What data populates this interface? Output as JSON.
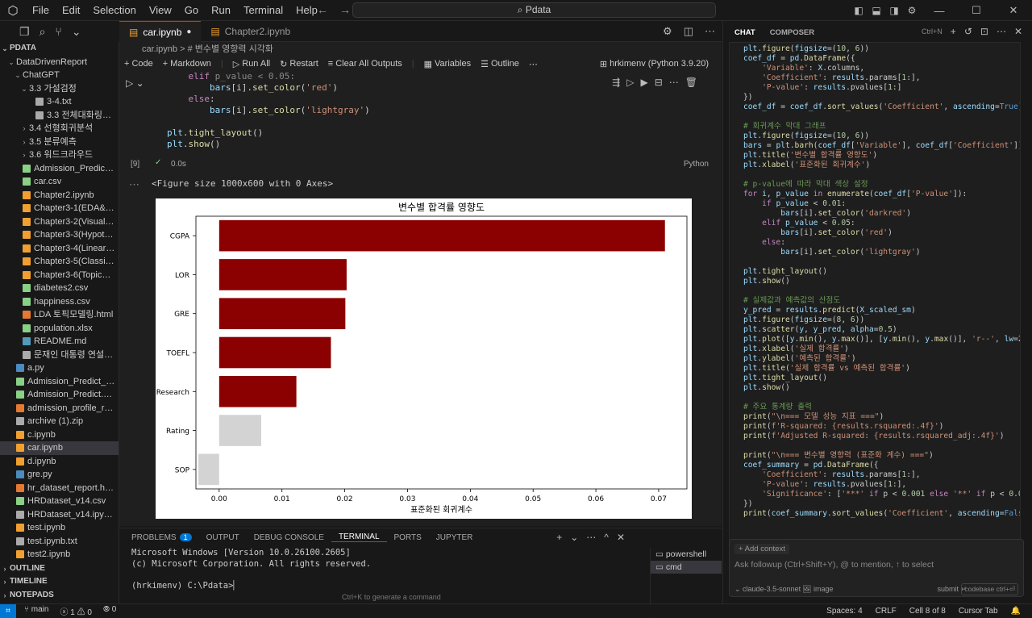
{
  "app": {
    "search": "Pdata"
  },
  "menu": [
    "File",
    "Edit",
    "Selection",
    "View",
    "Go",
    "Run",
    "Terminal",
    "Help"
  ],
  "explorer": {
    "root": "PDATA",
    "items": [
      {
        "label": "DataDrivenReport",
        "indent": 1,
        "type": "folder-open"
      },
      {
        "label": "ChatGPT",
        "indent": 2,
        "type": "folder-open"
      },
      {
        "label": "3.3 가설검정",
        "indent": 3,
        "type": "folder-open"
      },
      {
        "label": "3-4.txt",
        "indent": 4,
        "type": "txt"
      },
      {
        "label": "3.3 전체대화링크.txt",
        "indent": 4,
        "type": "txt"
      },
      {
        "label": "3.4 선형회귀분석",
        "indent": 3,
        "type": "folder"
      },
      {
        "label": "3.5 분류예측",
        "indent": 3,
        "type": "folder"
      },
      {
        "label": "3.6 워드크라우드",
        "indent": 3,
        "type": "folder"
      },
      {
        "label": "Admission_Predict.csv",
        "indent": 2,
        "type": "csv"
      },
      {
        "label": "car.csv",
        "indent": 2,
        "type": "csv"
      },
      {
        "label": "Chapter2.ipynb",
        "indent": 2,
        "type": "ipynb"
      },
      {
        "label": "Chapter3-1(EDA&Descrip...",
        "indent": 2,
        "type": "ipynb"
      },
      {
        "label": "Chapter3-2(Visualization)...",
        "indent": 2,
        "type": "ipynb"
      },
      {
        "label": "Chapter3-3(Hypothesis_t...",
        "indent": 2,
        "type": "ipynb"
      },
      {
        "label": "Chapter3-4(Linear_Regre...",
        "indent": 2,
        "type": "ipynb"
      },
      {
        "label": "Chapter3-5(Classification...",
        "indent": 2,
        "type": "ipynb"
      },
      {
        "label": "Chapter3-6(TopicModeli...",
        "indent": 2,
        "type": "ipynb"
      },
      {
        "label": "diabetes2.csv",
        "indent": 2,
        "type": "csv"
      },
      {
        "label": "happiness.csv",
        "indent": 2,
        "type": "csv"
      },
      {
        "label": "LDA 토픽모델링.html",
        "indent": 2,
        "type": "html"
      },
      {
        "label": "population.xlsx",
        "indent": 2,
        "type": "csv"
      },
      {
        "label": "README.md",
        "indent": 2,
        "type": "md"
      },
      {
        "label": "문재인 대통령 연설문 선...",
        "indent": 2,
        "type": "txt"
      },
      {
        "label": "a.py",
        "indent": 1,
        "type": "py"
      },
      {
        "label": "Admission_Predict_Ver1.1....",
        "indent": 1,
        "type": "csv"
      },
      {
        "label": "Admission_Predict.csv",
        "indent": 1,
        "type": "csv"
      },
      {
        "label": "admission_profile_report.h...",
        "indent": 1,
        "type": "html"
      },
      {
        "label": "archive (1).zip",
        "indent": 1,
        "type": "zip"
      },
      {
        "label": "c.ipynb",
        "indent": 1,
        "type": "ipynb"
      },
      {
        "label": "car.ipynb",
        "indent": 1,
        "type": "ipynb",
        "selected": true
      },
      {
        "label": "d.ipynb",
        "indent": 1,
        "type": "ipynb"
      },
      {
        "label": "gre.py",
        "indent": 1,
        "type": "py"
      },
      {
        "label": "hr_dataset_report.html",
        "indent": 1,
        "type": "html"
      },
      {
        "label": "HRDataset_v14.csv",
        "indent": 1,
        "type": "csv"
      },
      {
        "label": "HRDataset_v14.ipynb.txt",
        "indent": 1,
        "type": "txt"
      },
      {
        "label": "test.ipynb",
        "indent": 1,
        "type": "ipynb"
      },
      {
        "label": "test.ipynb.txt",
        "indent": 1,
        "type": "txt"
      },
      {
        "label": "test2.ipynb",
        "indent": 1,
        "type": "ipynb"
      }
    ],
    "sections": [
      "OUTLINE",
      "TIMELINE",
      "NOTEPADS"
    ]
  },
  "tabs": [
    {
      "label": "car.ipynb",
      "active": true,
      "dirty": true
    },
    {
      "label": "Chapter2.ipynb",
      "active": false
    }
  ],
  "breadcrumb": "car.ipynb  >  # 변수별 영향력 시각화",
  "toolbar": {
    "code": "Code",
    "markdown": "Markdown",
    "run_all": "Run All",
    "restart": "Restart",
    "clear": "Clear All Outputs",
    "variables": "Variables",
    "outline": "Outline",
    "kernel": "hrkimenv (Python 3.9.20)"
  },
  "cell": {
    "exec_count": "[9]",
    "duration": "0.0s",
    "language": "Python",
    "figure_text": "<Figure size 1000x600 with 0 Axes>"
  },
  "chart_data": {
    "type": "bar",
    "orientation": "horizontal",
    "title": "변수별 합격률 영향도",
    "xlabel": "표준화된 회귀계수",
    "ylabel": "",
    "categories": [
      "CGPA",
      "LOR",
      "GRE",
      "TOEFL",
      "Research",
      "Rating",
      "SOP"
    ],
    "values": [
      0.071,
      0.0203,
      0.0201,
      0.0178,
      0.0123,
      0.0067,
      -0.0033
    ],
    "bar_colors": [
      "#8b0000",
      "#8b0000",
      "#8b0000",
      "#8b0000",
      "#8b0000",
      "#d3d3d3",
      "#d3d3d3"
    ],
    "xticks": [
      "0.00",
      "0.01",
      "0.02",
      "0.03",
      "0.04",
      "0.05",
      "0.06",
      "0.07"
    ],
    "xlim": [
      -0.0037,
      0.0745
    ],
    "grid": false
  },
  "panel": {
    "tabs": [
      "PROBLEMS",
      "OUTPUT",
      "DEBUG CONSOLE",
      "TERMINAL",
      "PORTS",
      "JUPYTER"
    ],
    "problems_count": "1",
    "terminal_lines": [
      "Microsoft Windows [Version 10.0.26100.2605]",
      "(c) Microsoft Corporation. All rights reserved.",
      "",
      "(hrkimenv) C:\\Pdata>"
    ],
    "hint": "Ctrl+K to generate a command",
    "terminals": [
      "powershell",
      "cmd"
    ]
  },
  "chat": {
    "tabs": [
      "CHAT",
      "COMPOSER"
    ],
    "shortcut": "Ctrl+N",
    "add_context": "+ Add context",
    "placeholder": "Ask followup (Ctrl+Shift+Y), @ to mention, ↑ to select",
    "model": "claude-3.5-sonnet",
    "image": "image",
    "submit": "submit ↵",
    "codebase": "codebase ctrl+⏎"
  },
  "status": {
    "branch": "main",
    "errors": "1",
    "warnings": "0",
    "ports": "0",
    "spaces": "Spaces: 4",
    "eol": "CRLF",
    "cell": "Cell 8 of 8",
    "tab": "Cursor Tab"
  }
}
